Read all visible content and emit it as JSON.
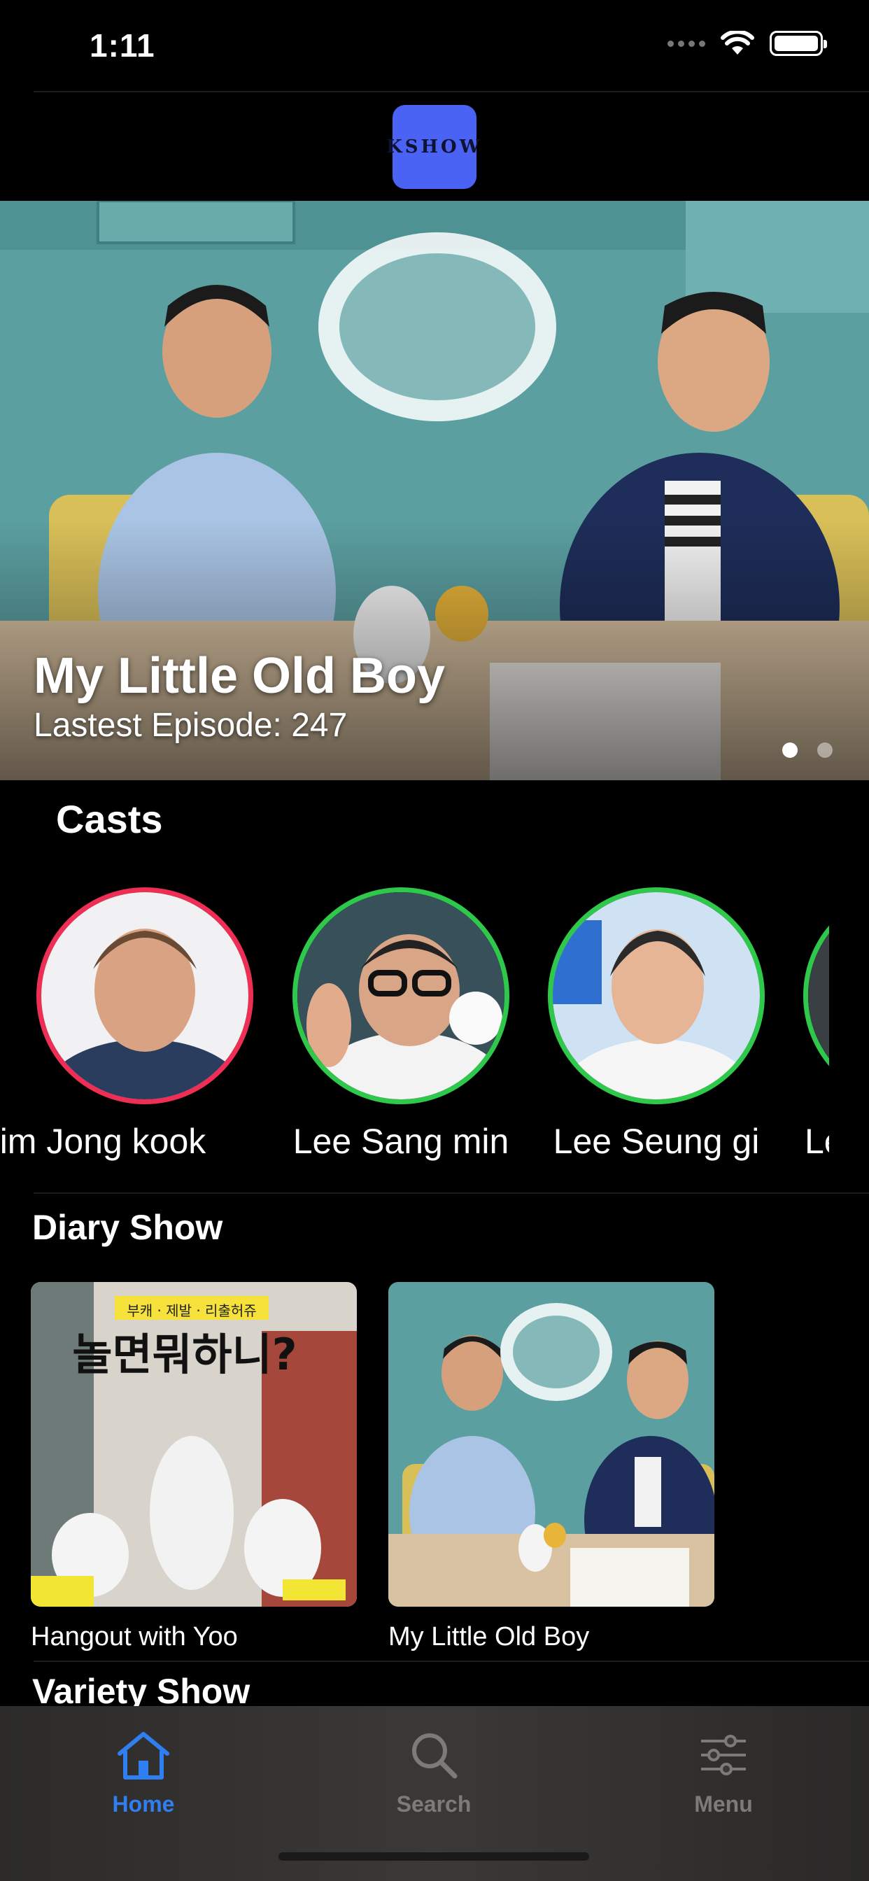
{
  "status_bar": {
    "time": "1:11"
  },
  "header": {
    "logo_text": "KSHOW"
  },
  "hero": {
    "title": "My Little Old Boy",
    "subtitle": "Lastest Episode: 247",
    "slide_count": 2,
    "active_slide": 1
  },
  "casts": {
    "title": "Casts",
    "items": [
      {
        "name": "im Jong kook",
        "ring_color": "#ee2e55"
      },
      {
        "name": "Lee Sang min",
        "ring_color": "#2ec84a"
      },
      {
        "name": "Lee Seung gi",
        "ring_color": "#2ec84a"
      },
      {
        "name": "Le",
        "ring_color": "#2ec84a"
      }
    ]
  },
  "diary_show": {
    "title": "Diary Show",
    "items": [
      {
        "label": "Hangout with Yoo"
      },
      {
        "label": "My Little Old Boy"
      }
    ]
  },
  "variety_show": {
    "title": "Variety Show"
  },
  "tab_bar": {
    "items": [
      {
        "label": "Home",
        "icon": "house-icon",
        "active": true
      },
      {
        "label": "Search",
        "icon": "magnifier-icon",
        "active": false
      },
      {
        "label": "Menu",
        "icon": "sliders-icon",
        "active": false
      }
    ],
    "active_color": "#2f7ef2",
    "inactive_color": "#7d7b79"
  }
}
